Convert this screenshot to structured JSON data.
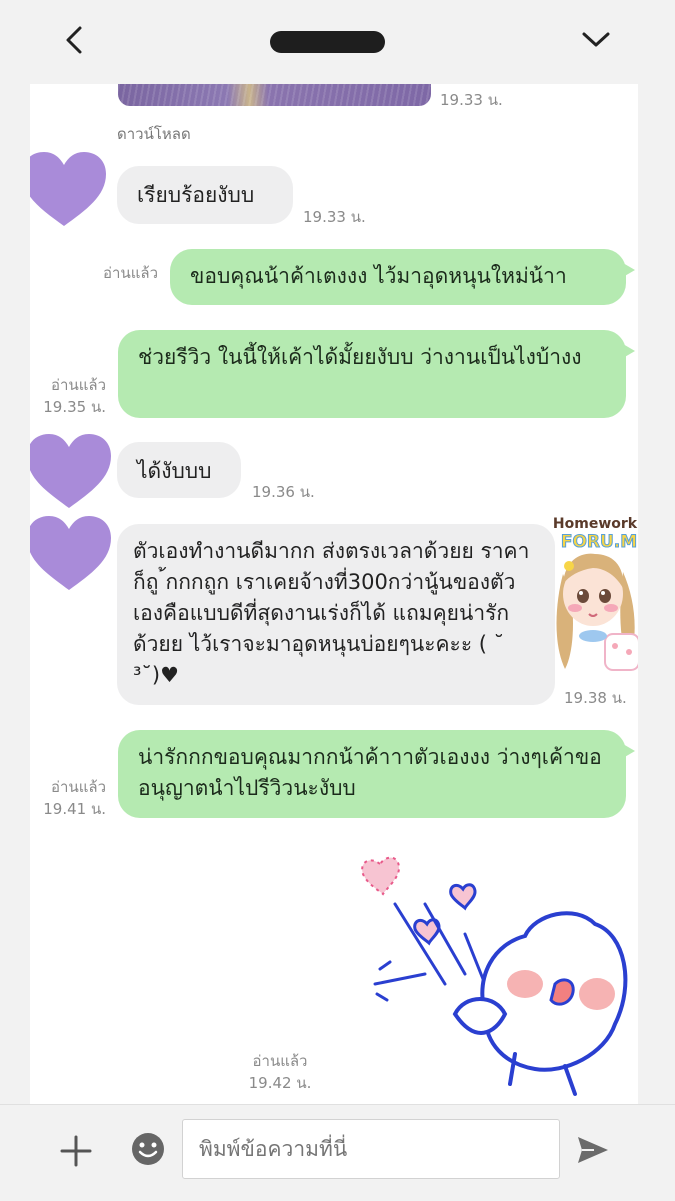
{
  "header": {
    "back_icon": "chevron-left-icon",
    "menu_icon": "chevron-down-icon"
  },
  "messages": {
    "image_time": "19.33 น.",
    "download_label": "ดาวน์โหลด",
    "m1": {
      "text": "เรียบร้อยงับบ",
      "time": "19.33 น."
    },
    "m2": {
      "text": "ขอบคุณน้าค้าเตงงง ไว้มาอุดหนุนใหม่น้าา",
      "read": "อ่านแล้ว"
    },
    "m3": {
      "text": "ช่วยรีวิว ในนี้ให้เค้าได้มั้ยยงับบ ว่างานเป็นไงบ้างง",
      "read": "อ่านแล้ว",
      "time": "19.35 น."
    },
    "m4": {
      "text": "ได้งับบบ",
      "time": "19.36 น."
    },
    "m5": {
      "text": "ตัวเองทำงานดีมากก ส่งตรงเวลาด้วยย ราคาก็ถู ้กกกถูก เราเคยจ้างที่300กว่านู้นของตัวเองคือแบบดีที่สุดงานเร่งก็ได้ แถมคุยน่ารักด้วยย ไว้เราจะมาอุดหนุนบ่อยๆนะคะะ ( ˘ ³˘)♥",
      "time": "19.38 น."
    },
    "m6": {
      "text": "น่ารักกกขอบคุณมากกน้าค้าาาตัวเองงง ว่างๆเค้าขออนุญาตนำไปรีวิวนะงับบ",
      "read": "อ่านแล้ว",
      "time": "19.41 น."
    },
    "m7": {
      "read": "อ่านแล้ว",
      "time": "19.42 น."
    },
    "sticker_text": {
      "line1": "Homework",
      "line2": "FORU.M"
    }
  },
  "composer": {
    "placeholder": "พิมพ์ข้อความที่นี่",
    "plus_icon": "plus-icon",
    "emoji_icon": "emoji-icon",
    "send_icon": "send-icon"
  },
  "colors": {
    "outgoing": "#b5eab1",
    "incoming": "#eeeeef",
    "avatar": "#a98bd9"
  }
}
